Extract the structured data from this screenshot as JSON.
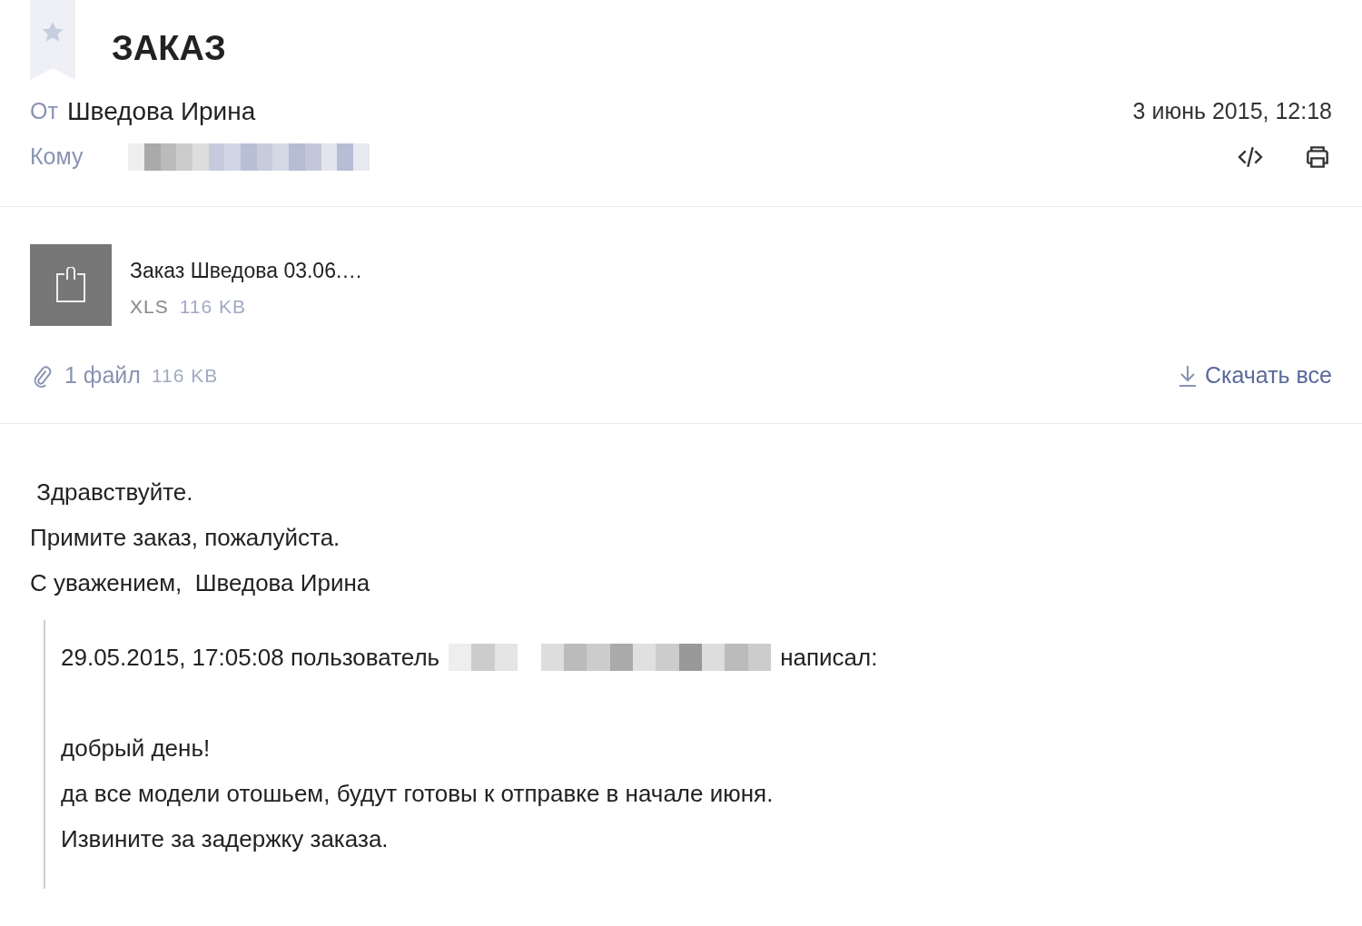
{
  "message": {
    "flagged": false,
    "subject": "ЗАКАЗ",
    "from_label": "От",
    "from_name": "Шведова Ирина",
    "date": "3 июнь 2015, 12:18",
    "to_label": "Кому"
  },
  "attachments": [
    {
      "name": "Заказ Шведова 03.06.…",
      "type": "XLS",
      "size": "116 KB"
    }
  ],
  "attachments_summary": {
    "count": "1 файл",
    "size": "116 KB",
    "download_all": "Скачать все"
  },
  "body": [
    " Здравствуйте.",
    "Примите заказ, пожалуйста.",
    "С уважением,  Шведова Ирина"
  ],
  "quote": {
    "header_before": "29.05.2015, 17:05:08 пользователь",
    "header_after": "написал:",
    "lines": [
      "добрый день!",
      "да все модели отошьем, будут готовы к отправке в начале июня.",
      "Извините за задержку заказа."
    ]
  }
}
